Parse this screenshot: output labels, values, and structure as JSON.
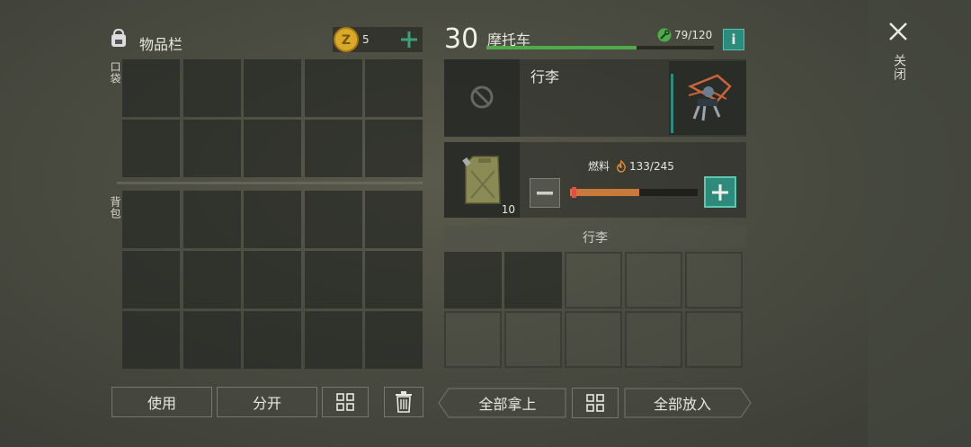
{
  "inventory": {
    "title": "物品栏",
    "coins": "5",
    "pocket_label": "口袋",
    "backpack_label": "背包"
  },
  "vehicle": {
    "level": "30",
    "name": "摩托车",
    "durability": "79/120",
    "durability_fraction": 0.66,
    "info_label": "i",
    "trunk_title": "行李",
    "fuel_label": "燃料",
    "fuel_value": "133/245",
    "fuel_fraction": 0.543,
    "fuel_item_count": "10",
    "trunk_section_label": "行李"
  },
  "buttons": {
    "use": "使用",
    "split": "分开",
    "take_all": "全部拿上",
    "put_all": "全部放入",
    "close": "关闭"
  },
  "colors": {
    "accent_green": "#3ea07a",
    "durability_bar": "#4faa4a",
    "fuel_bar": "#c9793a",
    "info_btn": "#2a8c7c"
  }
}
